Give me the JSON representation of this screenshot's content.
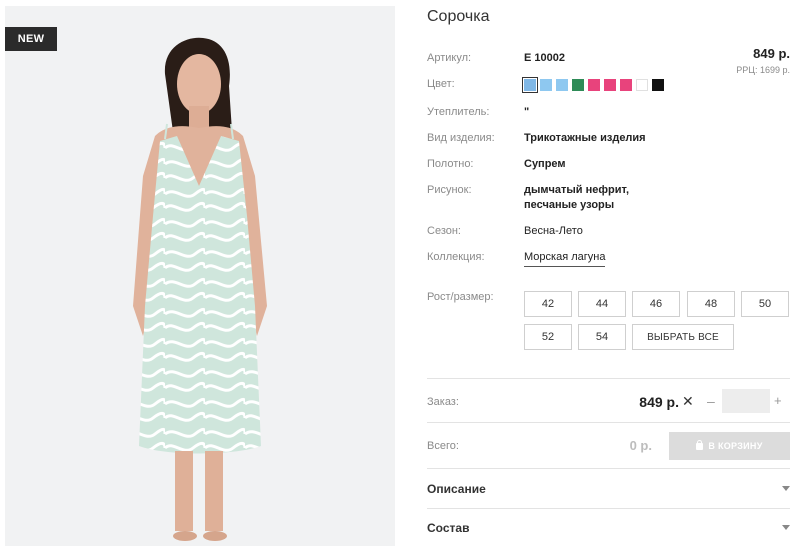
{
  "badge": "NEW",
  "product": {
    "title": "Сорочка",
    "price": "849 р.",
    "rrp": "РРЦ: 1699 р."
  },
  "details": {
    "article_label": "Артикул:",
    "article": "Е 10002",
    "color_label": "Цвет:",
    "insulation_label": "Утеплитель:",
    "insulation": "\"",
    "type_label": "Вид изделия:",
    "type": "Трикотажные изделия",
    "fabric_label": "Полотно:",
    "fabric": "Супрем",
    "pattern_label": "Рисунок:",
    "pattern_line1": "дымчатый нефрит,",
    "pattern_line2": "песчаные узоры",
    "season_label": "Сезон:",
    "season": "Весна-Лето",
    "collection_label": "Коллекция:",
    "collection": "Морская лагуна",
    "size_label": "Рост/размер:"
  },
  "colors": [
    "#7fb7e6",
    "#8ec8f0",
    "#8ec8f0",
    "#2e8b57",
    "#e8437c",
    "#e8437c",
    "#e8437c",
    "#ffffff",
    "#111111"
  ],
  "sizes": [
    "42",
    "44",
    "46",
    "48",
    "50",
    "52",
    "54"
  ],
  "select_all": "ВЫБРАТЬ ВСЕ",
  "order": {
    "label": "Заказ:",
    "price": "849 р.",
    "times": "✕",
    "minus": "–",
    "plus": "+",
    "qty": ""
  },
  "total": {
    "label": "Всего:",
    "price": "0 р.",
    "cart_button": "В КОРЗИНУ"
  },
  "accordion": [
    "Описание",
    "Состав"
  ]
}
